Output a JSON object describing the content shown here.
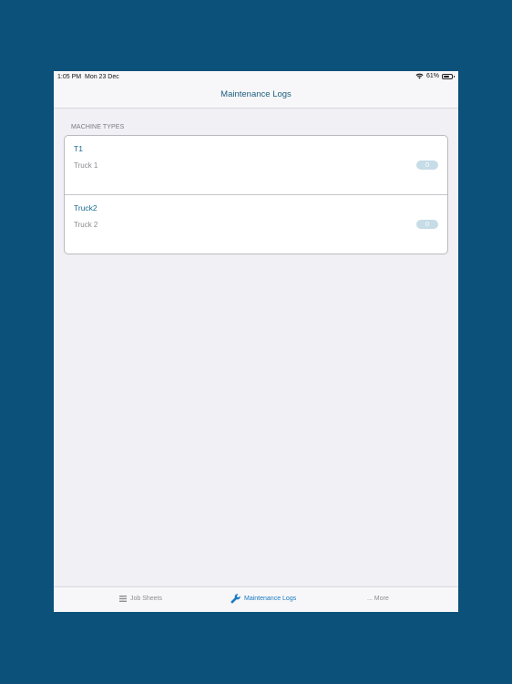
{
  "status": {
    "time": "1:05 PM",
    "date": "Mon 23 Dec",
    "battery": "61%"
  },
  "nav": {
    "title": "Maintenance Logs"
  },
  "section": {
    "header": "MACHINE TYPES"
  },
  "machines": [
    {
      "title": "T1",
      "subtitle": "Truck 1",
      "count": "0"
    },
    {
      "title": "Truck2",
      "subtitle": "Truck 2",
      "count": "0"
    }
  ],
  "tabs": [
    {
      "label": "Job Sheets",
      "icon": "list-icon"
    },
    {
      "label": "Maintenance Logs",
      "icon": "wrench-icon",
      "active": true
    },
    {
      "label": "... More",
      "icon": "none"
    }
  ],
  "colors": {
    "background": "#0b5179",
    "accent": "#1a7ac0",
    "title": "#1d5f7d"
  }
}
